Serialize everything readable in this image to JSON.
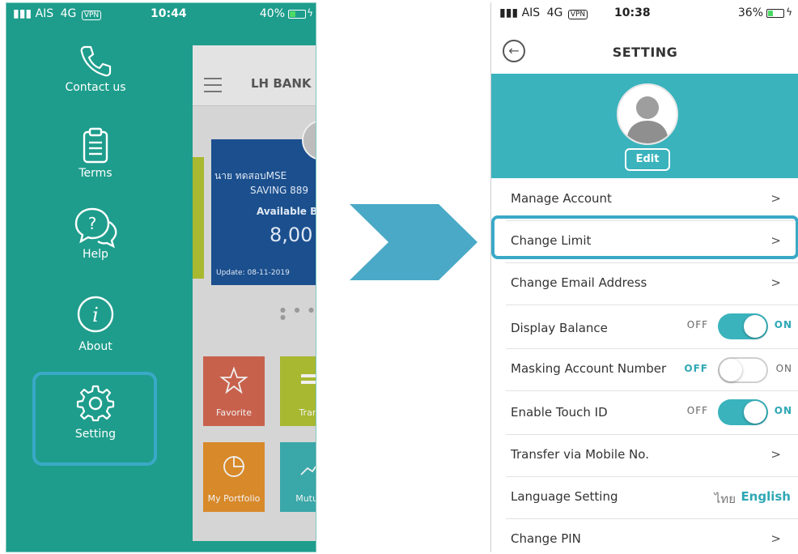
{
  "left_phone": {
    "status": {
      "carrier": "AIS",
      "network": "4G",
      "vpn": "VPN",
      "time": "10:44",
      "battery": "40%"
    },
    "menu": [
      {
        "label": "Contact us",
        "icon": "phone-icon"
      },
      {
        "label": "Terms",
        "icon": "clipboard-icon"
      },
      {
        "label": "Help",
        "icon": "help-bubble-icon"
      },
      {
        "label": "About",
        "icon": "info-icon"
      },
      {
        "label": "Setting",
        "icon": "gear-icon"
      }
    ],
    "preview": {
      "brand": "LH BANK",
      "account_name": "นาย ทดสอบMSE",
      "account_type": "SAVING 889",
      "available_label": "Available B",
      "balance": "8,00",
      "update": "Update: 08-11-2019",
      "tiles": [
        "Favorite",
        "Trans",
        "My Portfolio",
        "Mutual"
      ]
    }
  },
  "right_phone": {
    "status": {
      "carrier": "AIS",
      "network": "4G",
      "vpn": "VPN",
      "time": "10:38",
      "battery": "36%"
    },
    "title": "SETTING",
    "edit_label": "Edit",
    "rows": {
      "manage_account": "Manage Account",
      "change_limit": "Change Limit",
      "change_email": "Change Email Address",
      "display_balance": "Display Balance",
      "masking_account": "Masking Account Number",
      "touch_id": "Enable Touch ID",
      "transfer_mobile": "Transfer via Mobile No.",
      "language": "Language Setting",
      "change_pin": "Change PIN"
    },
    "chevron": ">",
    "off_label": "OFF",
    "on_label": "ON",
    "lang_thai": "ไทย",
    "lang_english": "English"
  },
  "colors": {
    "drawer": "#1e9d8c",
    "accent": "#3ab3bd",
    "highlight": "#3aa9c7"
  }
}
